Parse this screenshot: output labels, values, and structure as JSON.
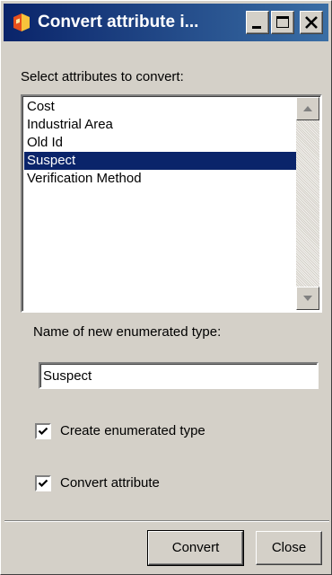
{
  "window": {
    "title": "Convert attribute i...",
    "minimize_icon": "minimize-icon",
    "maximize_icon": "maximize-icon",
    "close_icon": "close-icon",
    "app_icon": "app-icon"
  },
  "attributes": {
    "label": "Select attributes to convert:",
    "items": [
      {
        "label": "Cost",
        "selected": false
      },
      {
        "label": "Industrial Area",
        "selected": false
      },
      {
        "label": "Old Id",
        "selected": false
      },
      {
        "label": "Suspect",
        "selected": true
      },
      {
        "label": "Verification Method",
        "selected": false
      }
    ]
  },
  "enum_name": {
    "label": "Name of new enumerated type:",
    "value": "Suspect"
  },
  "options": {
    "create_enum": {
      "label": "Create enumerated type",
      "checked": true
    },
    "convert_attribute": {
      "label": "Convert attribute",
      "checked": true
    }
  },
  "buttons": {
    "convert": "Convert",
    "close": "Close"
  },
  "colors": {
    "selection": "#0a246a",
    "face": "#d4d0c8"
  }
}
